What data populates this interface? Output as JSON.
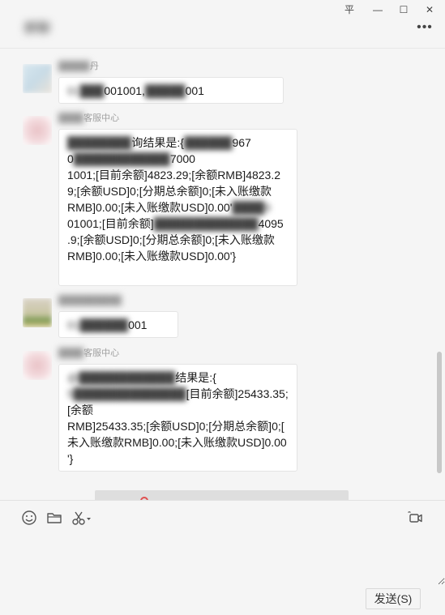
{
  "window": {
    "title": "群聊",
    "controls": {
      "pin": "平",
      "minimize": "—",
      "maximize": "☐",
      "close": "✕"
    },
    "more_label": "•••"
  },
  "messages": [
    {
      "sender": "丹",
      "sender_blur": "█████",
      "text_blur": "01",
      "text": "001001,",
      "text_tail": "001"
    },
    {
      "sender_blur": "████",
      "sender": "客服中心",
      "segments": [
        {
          "blur": true,
          "text": "@",
          "blur_text": "████████"
        },
        {
          "blur": false,
          "text": "询结果是:{"
        },
        {
          "blur": true,
          "text": "██████"
        },
        {
          "blur": false,
          "text": "967\n0"
        },
        {
          "blur": true,
          "text": "████████████"
        },
        {
          "blur": false,
          "text": "7000\n1001;[目前余额]4823.29;[余额RMB]4823.2\n9;[余额USD]0;[分期总余额]0;[未入账缴款\nRMB]0.00;[未入账缴款USD]0.00'"
        },
        {
          "blur": true,
          "text": "████9\n"
        },
        {
          "blur": false,
          "text": "01001;[目前余额]"
        },
        {
          "blur": true,
          "text": "█████████████"
        },
        {
          "blur": false,
          "text": "4095\n.9;[余额USD]0;[分期总余额]0;[未入账缴款\nRMB]0.00;[未入账缴款USD]0.00'}"
        }
      ]
    },
    {
      "sender_blur": "██████████",
      "text_blur": "01██████",
      "text": "001"
    },
    {
      "sender_blur": "████",
      "sender": "客服中心",
      "segments": [
        {
          "blur": true,
          "text": "@████████████"
        },
        {
          "blur": false,
          "text": "结果是:{\n"
        },
        {
          "blur": true,
          "text": "5██████████████"
        },
        {
          "blur": false,
          "text": "[目前余额]25433.35;[余额\nRMB]25433.35;[余额USD]0;[分期总余额]0;[\n未入账缴款RMB]0.00;[未入账缴款USD]0.00\n'}"
        }
      ]
    }
  ],
  "toolbar": {
    "emoji_icon": "emoji-icon",
    "folder_icon": "folder-icon",
    "scissors_icon": "scissors-icon",
    "video_call_icon": "video-call-icon"
  },
  "compose": {
    "value": "",
    "placeholder": ""
  },
  "send_button": "发送(S)",
  "colors": {
    "background": "#f5f5f5",
    "bubble": "#ffffff",
    "sender_text": "#a0a0a0",
    "accent_red": "#e05050"
  }
}
